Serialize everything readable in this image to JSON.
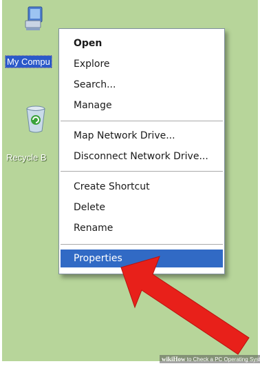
{
  "desktop": {
    "icons": [
      {
        "label": "My Compu",
        "name": "my-computer"
      },
      {
        "label": "Recycle B",
        "name": "recycle-bin"
      }
    ]
  },
  "context_menu": {
    "items": [
      {
        "label": "Open",
        "bold": true
      },
      {
        "label": "Explore"
      },
      {
        "label": "Search..."
      },
      {
        "label": "Manage"
      },
      {
        "label": "Map Network Drive..."
      },
      {
        "label": "Disconnect Network Drive..."
      },
      {
        "label": "Create Shortcut"
      },
      {
        "label": "Delete"
      },
      {
        "label": "Rename"
      },
      {
        "label": "Properties",
        "selected": true
      }
    ]
  },
  "annotation": {
    "arrow_color": "#e8201a"
  },
  "watermark": {
    "brand": "wiki",
    "brand_suffix": "How",
    "text": " to Check a PC Operating Syster"
  },
  "colors": {
    "desktop_bg": "#b7d59a",
    "selection": "#316ac5",
    "arrow": "#e8201a"
  }
}
